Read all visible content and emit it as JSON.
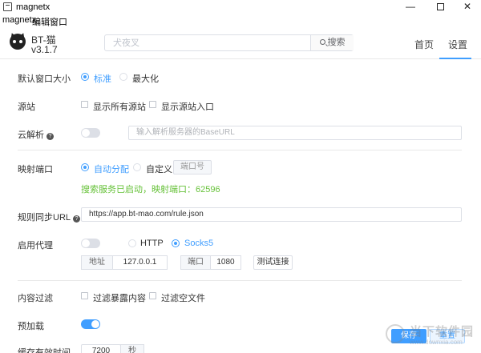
{
  "window": {
    "title": "magnetx",
    "minimize": "—",
    "close": "✕"
  },
  "menubar": {
    "items": [
      "magnetx",
      "编辑",
      "窗口"
    ]
  },
  "header": {
    "brand_name": "BT-猫",
    "version": "v3.1.7",
    "search_placeholder": "犬夜叉",
    "search_button": "搜索",
    "tabs": [
      "首页",
      "设置"
    ],
    "active_tab": "设置"
  },
  "settings": {
    "window_size": {
      "label": "默认窗口大小",
      "options": [
        "标准",
        "最大化"
      ],
      "selected": "标准"
    },
    "source": {
      "label": "源站",
      "options": [
        "显示所有源站",
        "显示源站入口"
      ]
    },
    "cloud": {
      "label": "云解析",
      "help": "?",
      "enabled": false,
      "placeholder": "输入解析服务器的BaseURL"
    },
    "port": {
      "label": "映射端口",
      "options": [
        "自动分配",
        "自定义"
      ],
      "selected": "自动分配",
      "port_placeholder": "端口号",
      "status": "搜索服务已启动，映射端口：62596"
    },
    "rule_sync": {
      "label": "规则同步URL",
      "help": "?",
      "value": "https://app.bt-mao.com/rule.json"
    },
    "proxy": {
      "label": "启用代理",
      "enabled": false,
      "options": [
        "HTTP",
        "Socks5"
      ],
      "selected": "Socks5",
      "address_label": "地址",
      "address_value": "127.0.0.1",
      "port_label": "端口",
      "port_value": "1080",
      "test_button": "测试连接"
    },
    "filter": {
      "label": "内容过滤",
      "options": [
        "过滤暴露内容",
        "过滤空文件"
      ]
    },
    "preload": {
      "label": "预加载",
      "enabled": true
    },
    "cache": {
      "label": "缓存有效时间",
      "value": "7200",
      "unit": "秒"
    }
  },
  "footer": {
    "save": "保存",
    "reset": "重置"
  },
  "watermark": {
    "text": "当下软件园",
    "sub": "www.downxia.com"
  }
}
